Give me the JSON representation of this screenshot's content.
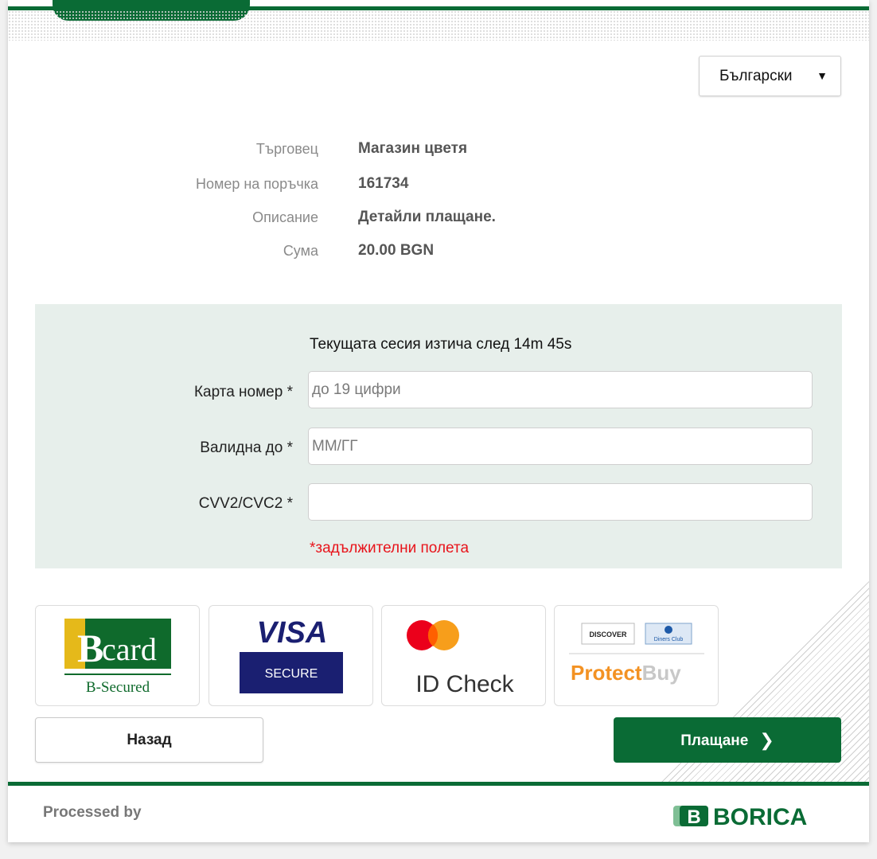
{
  "language": {
    "selected": "Български"
  },
  "order_info": [
    {
      "label": "Търговец",
      "value": "Магазин цветя"
    },
    {
      "label": "Номер на поръчка",
      "value": "161734"
    },
    {
      "label": "Описание",
      "value": "Детайли плащане."
    },
    {
      "label": "Сума",
      "value": "20.00 BGN"
    }
  ],
  "session": {
    "text": "Текущата сесия изтича след  14m 45s"
  },
  "fields": {
    "card_number": {
      "label": "Карта номер *",
      "placeholder": "до 19 цифри",
      "value": ""
    },
    "expiry": {
      "label": "Валидна до *",
      "placeholder": "ММ/ГГ",
      "value": ""
    },
    "cvv": {
      "label": "CVV2/CVC2 *",
      "placeholder": "",
      "value": ""
    }
  },
  "required_note": "*задължителни полета",
  "security_logos": {
    "bcard": {
      "brand": "Bcard",
      "subtitle": "B-Secured"
    },
    "visa": {
      "brand": "VISA",
      "subtitle": "SECURE"
    },
    "mastercard": {
      "subtitle": "ID Check"
    },
    "protectbuy": {
      "discover": "DISCOVER",
      "diners": "Diners Club",
      "brand_a": "Protect",
      "brand_b": "Buy"
    }
  },
  "buttons": {
    "back": "Назад",
    "pay": "Плащане"
  },
  "footer": {
    "processed_by": "Processed by",
    "brand": "BORICA"
  },
  "colors": {
    "brand_green": "#0a6b35",
    "panel_bg": "#e7efeb",
    "required_red": "#e8141b"
  }
}
